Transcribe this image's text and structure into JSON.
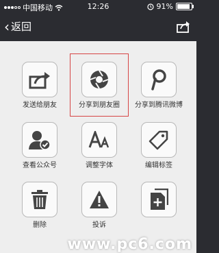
{
  "status_bar": {
    "carrier": "中国移动",
    "time": "12:26",
    "battery": "91%"
  },
  "nav": {
    "back_label": "返回"
  },
  "actions": [
    {
      "id": "send-to-friend",
      "label": "发送给朋友",
      "icon": "share-arrow-icon"
    },
    {
      "id": "share-moments",
      "label": "分享到朋友圈",
      "icon": "camera-shutter-icon",
      "highlighted": true
    },
    {
      "id": "share-tencent-weibo",
      "label": "分享到腾讯微博",
      "icon": "tencent-weibo-icon"
    },
    {
      "id": "view-official-account",
      "label": "查看公众号",
      "icon": "verified-user-icon"
    },
    {
      "id": "adjust-font",
      "label": "调整字体",
      "icon": "font-size-icon"
    },
    {
      "id": "edit-tags",
      "label": "编辑标签",
      "icon": "tag-icon"
    },
    {
      "id": "delete",
      "label": "删除",
      "icon": "trash-icon"
    },
    {
      "id": "complain",
      "label": "投诉",
      "icon": "warning-icon"
    },
    {
      "id": "copy-link",
      "label": "",
      "icon": "add-document-icon"
    }
  ],
  "watermark": {
    "text": "www.pc6.com"
  },
  "colors": {
    "nav_background": "#2b2c31",
    "panel_background": "#eeeeee",
    "highlight_border": "#d64444"
  }
}
